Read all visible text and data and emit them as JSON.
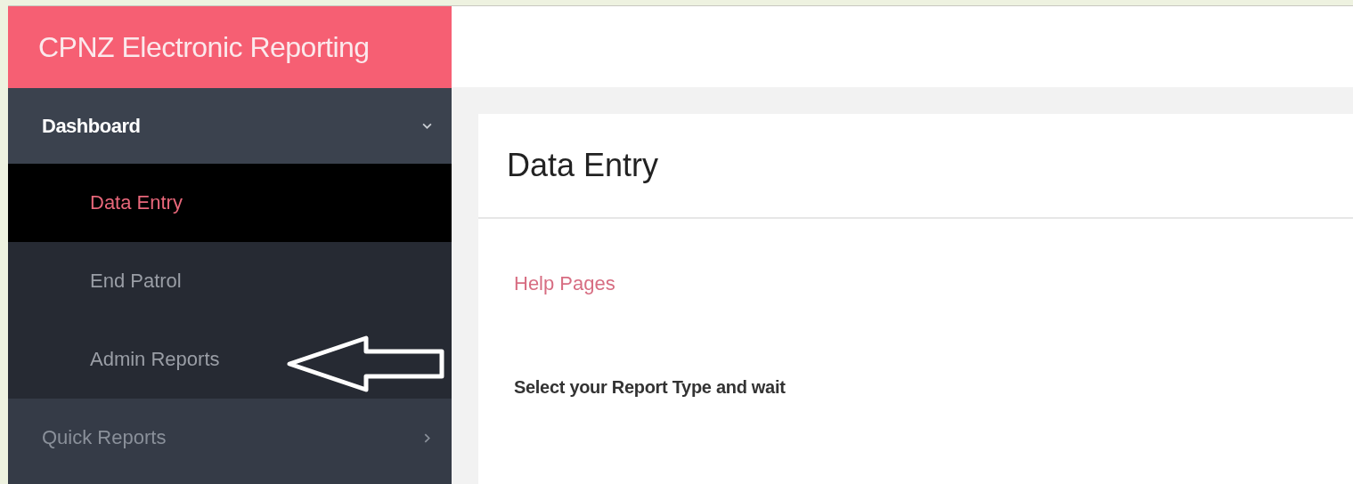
{
  "app_title": "CPNZ Electronic Reporting",
  "sidebar": {
    "items": [
      {
        "label": "Dashboard",
        "expanded": true,
        "children": [
          {
            "label": "Data Entry",
            "selected": true
          },
          {
            "label": "End Patrol",
            "selected": false
          },
          {
            "label": "Admin Reports",
            "selected": false
          }
        ]
      },
      {
        "label": "Quick Reports",
        "expanded": false
      }
    ]
  },
  "content": {
    "title": "Data Entry",
    "help_link": "Help Pages",
    "instruction": "Select your Report Type and wait"
  }
}
